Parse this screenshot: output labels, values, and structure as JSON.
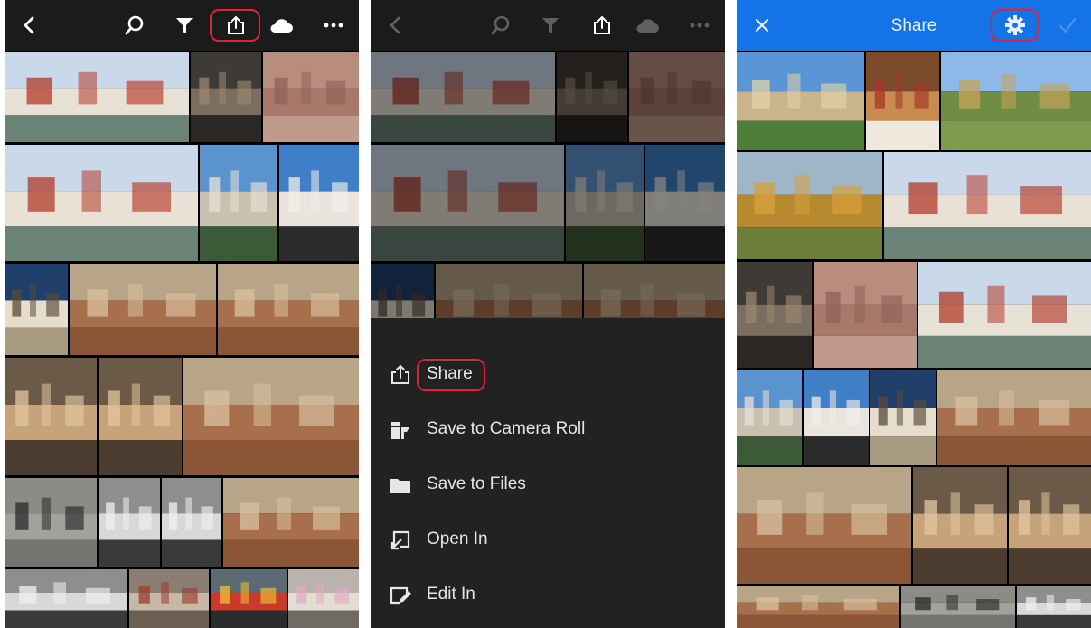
{
  "colors": {
    "toolbar_bg": "#1b1b1b",
    "menu_bg": "#222222",
    "share_bar_bg": "#1473e6",
    "highlight": "#e1223a",
    "icon_light": "#ffffff"
  },
  "panel_browse": {
    "toolbar": {
      "icons": [
        "back-chevron-icon",
        "search-icon",
        "filter-funnel-icon",
        "share-export-icon",
        "cloud-icon",
        "more-ellipsis-icon"
      ]
    },
    "photos": [
      "grand-canal-palazzos",
      "narrow-canal-alley",
      "weathered-pink-wall",
      "grand-canal-boats",
      "campanile-tower",
      "selfie-on-bridge",
      "doges-palace-facade",
      "rooftops-with-tower",
      "rooftops-panorama",
      "basilica-spire-angle",
      "basilica-gothic-detail",
      "terracotta-rooftops",
      "piazza-pedestrians",
      "cafe-chairs-topdown",
      "cafe-chairs-rows",
      "rooftops-sunlit",
      "cafe-tables-street",
      "wall-fountain-niche",
      "mcdonalds-doorway",
      "woman-in-alley"
    ]
  },
  "panel_menu": {
    "items": [
      {
        "label": "Share",
        "icon": "share-icon"
      },
      {
        "label": "Save to Camera Roll",
        "icon": "save-to-device-icon"
      },
      {
        "label": "Save to Files",
        "icon": "folder-icon"
      },
      {
        "label": "Open In",
        "icon": "open-in-icon"
      },
      {
        "label": "Edit In",
        "icon": "edit-in-icon"
      }
    ]
  },
  "panel_share": {
    "title": "Share",
    "icons": [
      "close-icon",
      "settings-gear-icon",
      "checkmark-icon"
    ]
  }
}
